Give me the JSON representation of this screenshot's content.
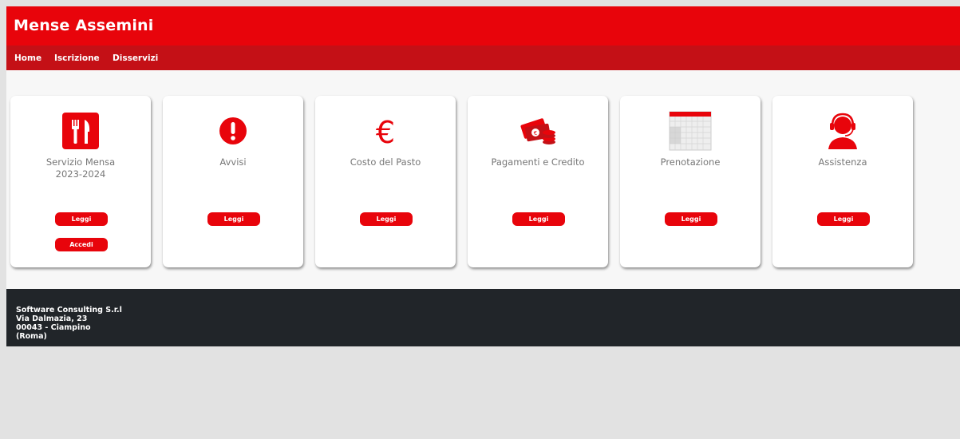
{
  "header": {
    "title": "Mense Assemini"
  },
  "nav": {
    "items": [
      {
        "label": "Home"
      },
      {
        "label": "Iscrizione"
      },
      {
        "label": "Disservizi"
      }
    ]
  },
  "cards": [
    {
      "title": "Servizio Mensa",
      "subtitle": "2023-2024",
      "icon": "fork-knife-icon",
      "button": "Leggi",
      "button2": "Accedi"
    },
    {
      "title": "Avvisi",
      "icon": "exclamation-icon",
      "button": "Leggi"
    },
    {
      "title": "Costo del Pasto",
      "icon": "euro-icon",
      "button": "Leggi"
    },
    {
      "title": "Pagamenti e Credito",
      "icon": "money-icon",
      "button": "Leggi"
    },
    {
      "title": "Prenotazione",
      "icon": "calendar-icon",
      "button": "Leggi"
    },
    {
      "title": "Assistenza",
      "icon": "headset-icon",
      "button": "Leggi"
    }
  ],
  "footer": {
    "lines": [
      "Software Consulting S.r.l",
      "Via Dalmazia, 23",
      "00043 - Ciampino",
      "(Roma)"
    ]
  },
  "colors": {
    "brand_red": "#e8040b",
    "nav_red": "#c41016",
    "footer_dark": "#212529"
  }
}
